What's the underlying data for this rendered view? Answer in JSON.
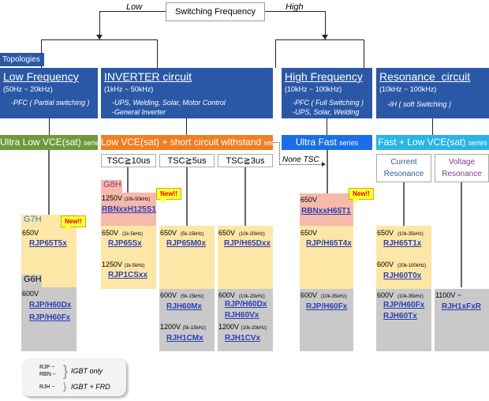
{
  "header": {
    "switching_frequency": "Switching Frequency",
    "low_label": "Low",
    "high_label": "High",
    "topologies_tab": "Topologies"
  },
  "topologies": [
    {
      "title": "Low Frequency",
      "range": "(50Hz ~ 20kHz)",
      "uses": [
        "-PFC ( Partial switching )"
      ]
    },
    {
      "title": "INVERTER circuit",
      "range": "(1kHz ~ 50kHz)",
      "uses": [
        "-UPS, Welding, Solar, Motor Control",
        "-General Inverter"
      ]
    },
    {
      "title": "High Frequency",
      "range": "(10kHz ~ 100kHz)",
      "uses": [
        "-PFC ( Full Switching )",
        "-UPS, Solar, Welding"
      ]
    },
    {
      "title": "Resonance  circuit",
      "range": "(10kHz ~ 100kHz)",
      "uses": [
        "-IH ( soft Switching )"
      ]
    }
  ],
  "series": [
    {
      "main": "Ultra Low VCE(sat)",
      "suffix": "series",
      "color": "#6f9a3c"
    },
    {
      "main": "Low VCE(sat) + short circuit withstand",
      "suffix": "series",
      "color": "#f07f22"
    },
    {
      "main": "Ultra Fast",
      "suffix": "series",
      "color": "#1a6fe8"
    },
    {
      "main": "Fast + Low VCE(sat)",
      "suffix": "series",
      "color": "#28b4e6"
    }
  ],
  "tsc": [
    "TSC≧10us",
    "TSC≧5us",
    "TSC≧3us"
  ],
  "none_tsc": "None TSC",
  "resonance": [
    {
      "line1": "Current",
      "line2": "Resonance",
      "color": "#2d5e9e"
    },
    {
      "line1": "Voltage",
      "line2": "Resonance",
      "color": "#7a3a9a"
    }
  ],
  "new_label": "New!!",
  "columns": {
    "col1": {
      "g7h": "G7H",
      "g7h_voltage": "650V",
      "g7h_part": "RJP65T5x",
      "g6h": "G6H",
      "g6h_voltage": "600V",
      "g6h_parts": [
        "RJP/H60Dx",
        "RJP/H60Fx"
      ]
    },
    "col2": {
      "g8h": "G8H",
      "g8h_voltage": "1250V",
      "g8h_freq": "(10k-50kHz)",
      "g8h_part": "RBNxxH125S1",
      "v1": "650V",
      "f1": "(1k-5kHz)",
      "p1": "RJP65Sx",
      "v2": "1250V",
      "f2": "(1k-5kHz)",
      "p2": "RJP1CSxx"
    },
    "col3": {
      "v1": "650V",
      "f1": "(5k-15kHz)",
      "p1": "RJP65M0x",
      "v2": "600V",
      "f2": "(5k-15kHz)",
      "p2": "RJH60Mx",
      "v3": "1200V",
      "f3": "(5k-15kHz)",
      "p3": "RJH1CMx"
    },
    "col4": {
      "v1": "650V",
      "f1": "(10k-20kHz)",
      "p1": "RJP/H65Dxx",
      "v2": "600V",
      "f2": "(10k-20kHz)",
      "p2a": "RJP/H60Dx",
      "p2b": "RJH60Vx",
      "v3": "1200V",
      "f3": "(10k-20kHz)",
      "p3": "RJH1CVx"
    },
    "col5": {
      "v0": "650V",
      "p0": "RBNxxH65T1",
      "v1": "650V",
      "p1": "RJP/H65T4x",
      "v2": "600V",
      "f2": "(10k-35kHz)",
      "p2": "RJP/H60Fx"
    },
    "col6": {
      "v1": "650V",
      "f1": "(10k-35kHz)",
      "p1": "RJH65T1x",
      "v2": "600V",
      "f2": "(20k-100kHz)",
      "p2": "RJH60T0x",
      "v3": "600V",
      "f3": "(10k-35kHz)",
      "p3a": "RJP/H60Fx",
      "p3b": "RJH60Tx"
    },
    "col7": {
      "v1": "1100V ~",
      "p1": "RJH1xFxR"
    }
  },
  "legend": {
    "rjp": "RJP ~",
    "rbn": "RBN ~",
    "igbt_only": "IGBT only",
    "rjh": "RJH ~",
    "igbt_frd": "IGBT + FRD"
  }
}
